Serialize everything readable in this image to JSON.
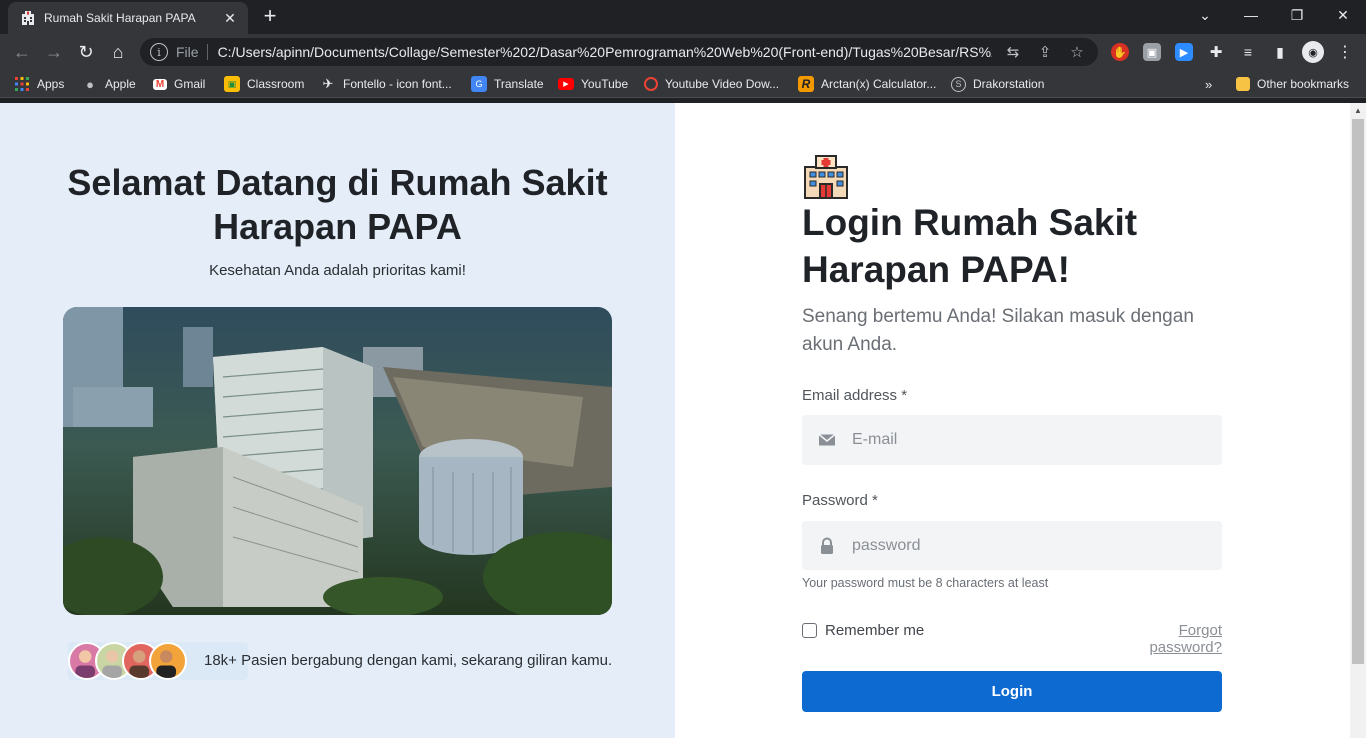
{
  "browser": {
    "tab_title": "Rumah Sakit Harapan PAPA",
    "url_scheme": "File",
    "url": "C:/Users/apinn/Documents/Collage/Semester%202/Dasar%20Pemrograman%20Web%20(Front-end)/Tugas%20Besar/RS%20...",
    "bookmarks": [
      {
        "label": "Apps",
        "icon": "apps-grid-icon"
      },
      {
        "label": "Apple",
        "icon": "apple-icon"
      },
      {
        "label": "Gmail",
        "icon": "gmail-icon"
      },
      {
        "label": "Classroom",
        "icon": "classroom-icon"
      },
      {
        "label": "Fontello - icon font...",
        "icon": "fontello-icon"
      },
      {
        "label": "Translate",
        "icon": "translate-icon"
      },
      {
        "label": "YouTube",
        "icon": "youtube-icon"
      },
      {
        "label": "Youtube Video Dow...",
        "icon": "download-icon"
      },
      {
        "label": "Arctan(x) Calculator...",
        "icon": "calculator-icon"
      },
      {
        "label": "Drakorstation",
        "icon": "drakor-icon"
      }
    ],
    "other_bookmarks": "Other bookmarks",
    "more_bookmarks": "»"
  },
  "welcome": {
    "title": "Selamat Datang di Rumah Sakit Harapan PAPA",
    "subtitle": "Kesehatan Anda adalah prioritas kami!",
    "joined_text": "18k+ Pasien bergabung dengan kami, sekarang giliran kamu."
  },
  "login": {
    "title": "Login Rumah Sakit Harapan PAPA!",
    "subtitle": "Senang bertemu Anda! Silakan masuk dengan akun Anda.",
    "email_label": "Email address *",
    "email_placeholder": "E-mail",
    "password_label": "Password *",
    "password_placeholder": "password",
    "password_hint": "Your password must be 8 characters at least",
    "remember_label": "Remember me",
    "forgot_label": "Forgot password?",
    "submit_label": "Login"
  },
  "colors": {
    "left_panel_bg": "#e5eef8",
    "primary": "#0d6ad1",
    "heading": "#1f2328"
  }
}
